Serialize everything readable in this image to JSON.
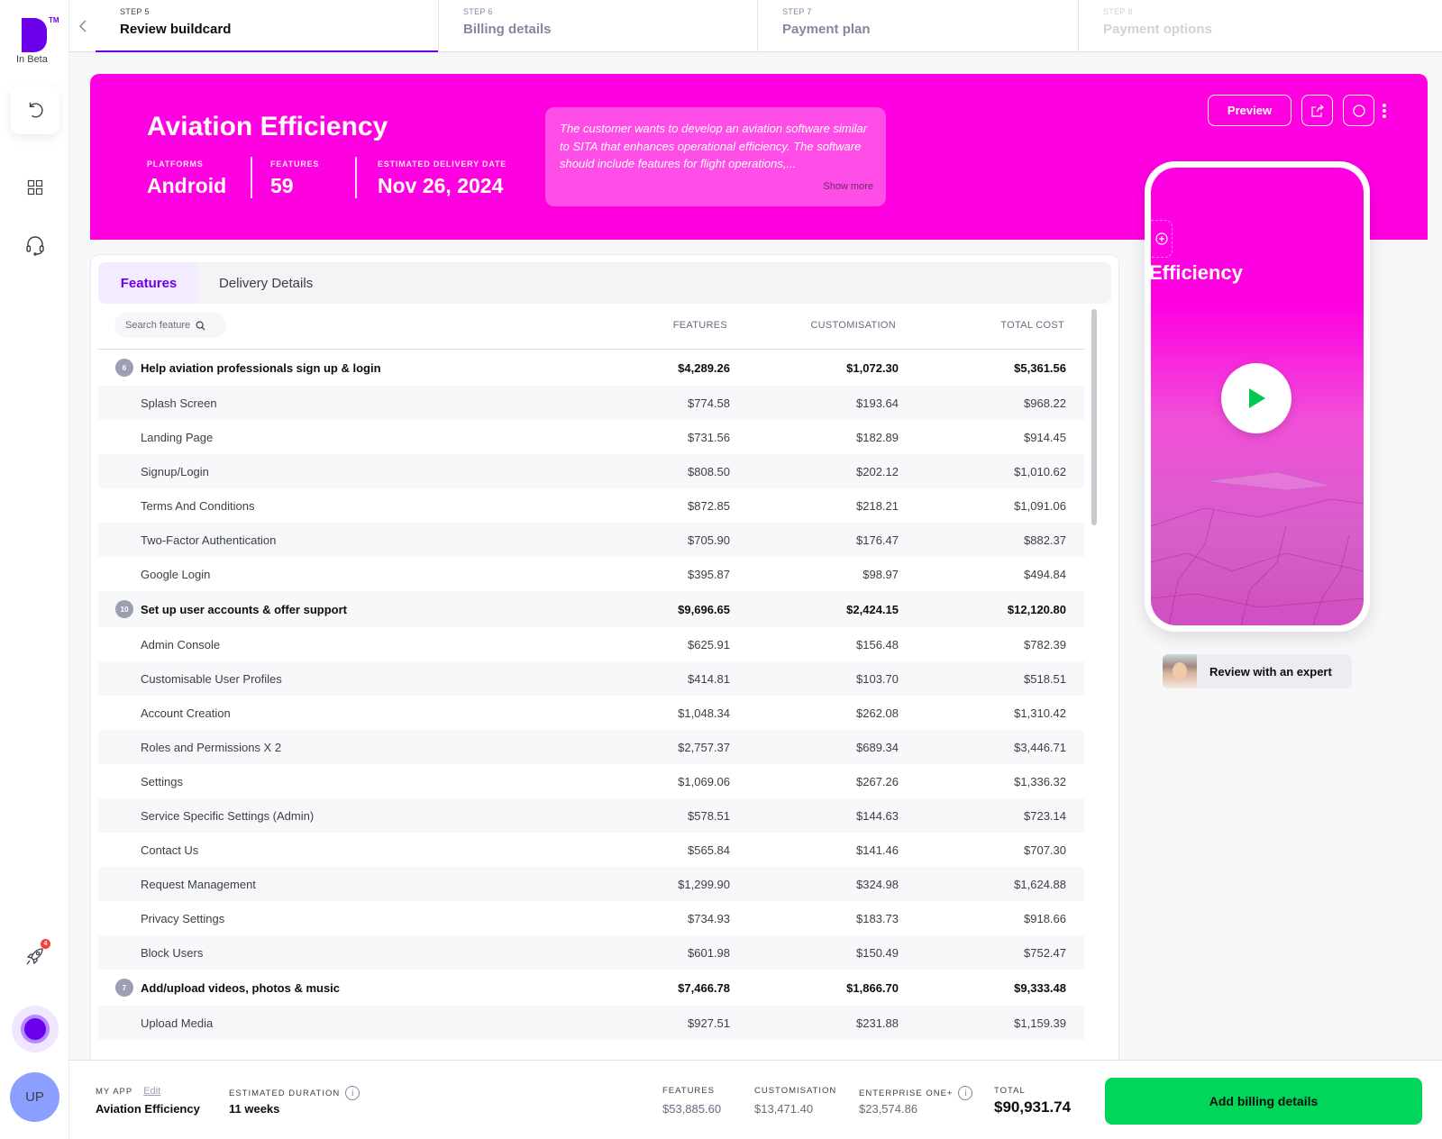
{
  "sidebar": {
    "logo_badge": "TM",
    "logo_caption": "In Beta",
    "items": [
      {
        "name": "undo",
        "icon": "undo-icon"
      },
      {
        "name": "dashboard",
        "icon": "grid-icon"
      },
      {
        "name": "support",
        "icon": "headset-icon"
      }
    ],
    "rocket_badge_count": "4",
    "user_initials": "UP"
  },
  "steps": [
    {
      "num": "STEP 5",
      "label": "Review buildcard",
      "state": "active"
    },
    {
      "num": "STEP 6",
      "label": "Billing details",
      "state": "next"
    },
    {
      "num": "STEP 7",
      "label": "Payment plan",
      "state": "next"
    },
    {
      "num": "STEP 8",
      "label": "Payment options",
      "state": "disabled"
    }
  ],
  "hero": {
    "title": "Aviation Efficiency",
    "platforms_label": "PLATFORMS",
    "platforms_value": "Android",
    "features_label": "FEATURES",
    "features_value": "59",
    "delivery_label": "ESTIMATED DELIVERY DATE",
    "delivery_value": "Nov 26, 2024",
    "description": "The customer wants to develop an aviation software similar to SITA that enhances operational efficiency. The software should include features for flight operations,...",
    "show_more": "Show more",
    "preview_label": "Preview",
    "accent_color": "#ff00e1"
  },
  "phone": {
    "title": "Efficiency",
    "expert_label": "Review with an expert"
  },
  "tabs": {
    "features": "Features",
    "delivery": "Delivery Details"
  },
  "table": {
    "search_placeholder": "Search feature",
    "headers": {
      "features": "FEATURES",
      "customisation": "CUSTOMISATION",
      "total": "TOTAL COST"
    },
    "rows": [
      {
        "type": "group",
        "badge": "6",
        "name": "Help aviation professionals sign up & login",
        "features": "$4,289.26",
        "customisation": "$1,072.30",
        "total": "$5,361.56"
      },
      {
        "type": "item",
        "name": "Splash Screen",
        "features": "$774.58",
        "customisation": "$193.64",
        "total": "$968.22"
      },
      {
        "type": "item",
        "name": "Landing Page",
        "features": "$731.56",
        "customisation": "$182.89",
        "total": "$914.45"
      },
      {
        "type": "item",
        "name": "Signup/Login",
        "features": "$808.50",
        "customisation": "$202.12",
        "total": "$1,010.62"
      },
      {
        "type": "item",
        "name": "Terms And Conditions",
        "features": "$872.85",
        "customisation": "$218.21",
        "total": "$1,091.06"
      },
      {
        "type": "item",
        "name": "Two-Factor Authentication",
        "features": "$705.90",
        "customisation": "$176.47",
        "total": "$882.37"
      },
      {
        "type": "item",
        "name": "Google Login",
        "features": "$395.87",
        "customisation": "$98.97",
        "total": "$494.84"
      },
      {
        "type": "group",
        "badge": "10",
        "name": "Set up user accounts & offer support",
        "features": "$9,696.65",
        "customisation": "$2,424.15",
        "total": "$12,120.80"
      },
      {
        "type": "item",
        "name": "Admin Console",
        "features": "$625.91",
        "customisation": "$156.48",
        "total": "$782.39"
      },
      {
        "type": "item",
        "name": "Customisable User Profiles",
        "features": "$414.81",
        "customisation": "$103.70",
        "total": "$518.51"
      },
      {
        "type": "item",
        "name": "Account Creation",
        "features": "$1,048.34",
        "customisation": "$262.08",
        "total": "$1,310.42"
      },
      {
        "type": "item",
        "name": "Roles and Permissions X 2",
        "features": "$2,757.37",
        "customisation": "$689.34",
        "total": "$3,446.71"
      },
      {
        "type": "item",
        "name": "Settings",
        "features": "$1,069.06",
        "customisation": "$267.26",
        "total": "$1,336.32"
      },
      {
        "type": "item",
        "name": "Service Specific Settings (Admin)",
        "features": "$578.51",
        "customisation": "$144.63",
        "total": "$723.14"
      },
      {
        "type": "item",
        "name": "Contact Us",
        "features": "$565.84",
        "customisation": "$141.46",
        "total": "$707.30"
      },
      {
        "type": "item",
        "name": "Request Management",
        "features": "$1,299.90",
        "customisation": "$324.98",
        "total": "$1,624.88"
      },
      {
        "type": "item",
        "name": "Privacy Settings",
        "features": "$734.93",
        "customisation": "$183.73",
        "total": "$918.66"
      },
      {
        "type": "item",
        "name": "Block Users",
        "features": "$601.98",
        "customisation": "$150.49",
        "total": "$752.47"
      },
      {
        "type": "group",
        "badge": "7",
        "name": "Add/upload videos, photos & music",
        "features": "$7,466.78",
        "customisation": "$1,866.70",
        "total": "$9,333.48"
      },
      {
        "type": "item",
        "name": "Upload Media",
        "features": "$927.51",
        "customisation": "$231.88",
        "total": "$1,159.39"
      }
    ]
  },
  "footer": {
    "my_app_label": "MY APP",
    "edit_label": "Edit",
    "app_name": "Aviation Efficiency",
    "duration_label": "ESTIMATED DURATION",
    "duration_value": "11 weeks",
    "features_label": "FEATURES",
    "features_value": "$53,885.60",
    "customisation_label": "CUSTOMISATION",
    "customisation_value": "$13,471.40",
    "enterprise_label": "ENTERPRISE ONE+",
    "enterprise_value": "$23,574.86",
    "total_label": "TOTAL",
    "total_value": "$90,931.74",
    "cta_label": "Add billing details",
    "cta_color": "#00d659"
  }
}
